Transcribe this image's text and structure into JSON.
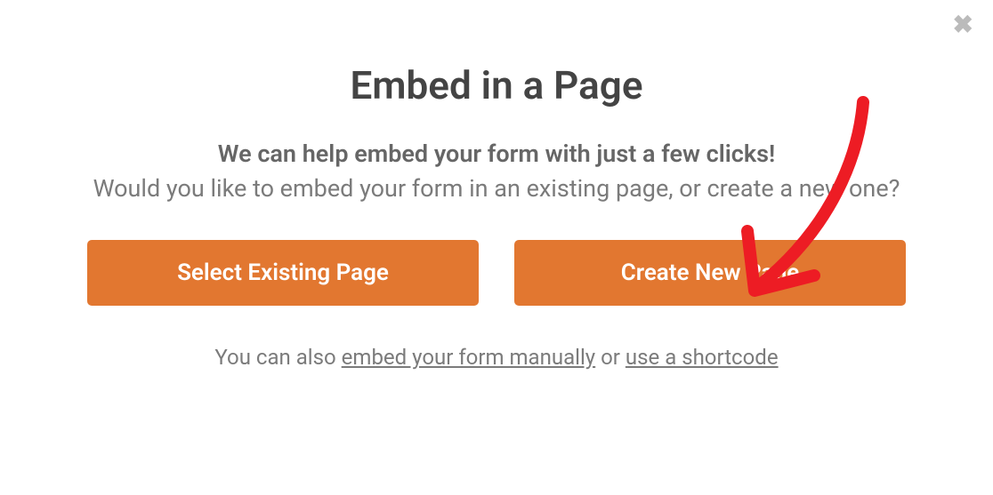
{
  "modal": {
    "title": "Embed in a Page",
    "subtitle_bold": "We can help embed your form with just a few clicks!",
    "subtitle_plain": "Would you like to embed your form in an existing page, or create a new one?",
    "buttons": {
      "existing": "Select Existing Page",
      "new": "Create New Page"
    },
    "footer": {
      "prefix": "You can also ",
      "link_manual": "embed your form manually",
      "or": " or ",
      "link_shortcode": "use a shortcode"
    }
  }
}
